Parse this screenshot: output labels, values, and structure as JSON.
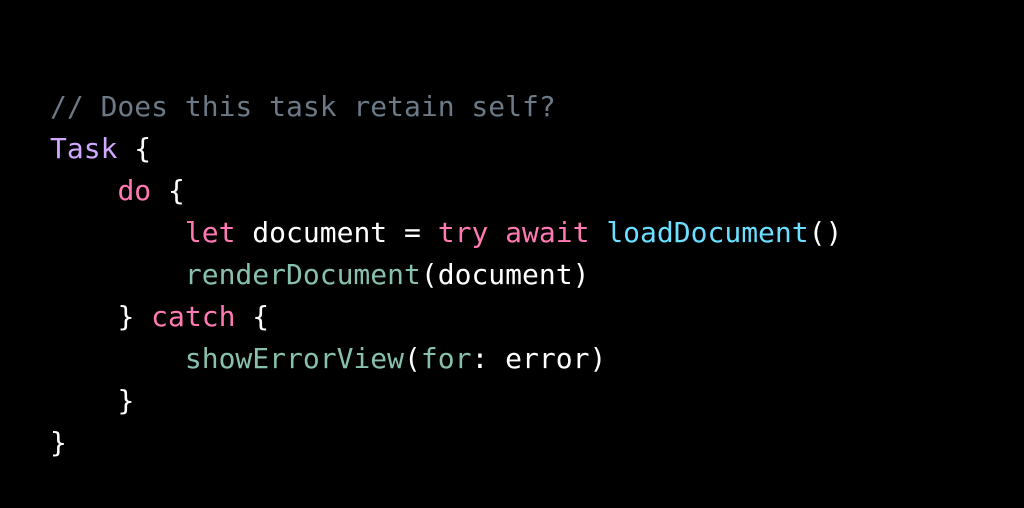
{
  "code": {
    "comment": "// Does this task retain self?",
    "line2": {
      "task": "Task",
      "brace": " {"
    },
    "line3": {
      "indent": "    ",
      "do": "do",
      "brace": " {"
    },
    "line4": {
      "indent": "        ",
      "let": "let",
      "sp1": " ",
      "var": "document",
      "eq": " = ",
      "try": "try",
      "sp2": " ",
      "await": "await",
      "sp3": " ",
      "fn": "loadDocument",
      "parens": "()"
    },
    "line5": {
      "indent": "        ",
      "fn": "renderDocument",
      "open": "(",
      "arg": "document",
      "close": ")"
    },
    "line6": {
      "indent": "    ",
      "close": "} ",
      "catch": "catch",
      "brace": " {"
    },
    "line7": {
      "indent": "        ",
      "fn": "showErrorView",
      "open": "(",
      "label": "for",
      "colon": ": ",
      "arg": "error",
      "close": ")"
    },
    "line8": {
      "indent": "    ",
      "brace": "}"
    },
    "line9": {
      "brace": "}"
    }
  }
}
